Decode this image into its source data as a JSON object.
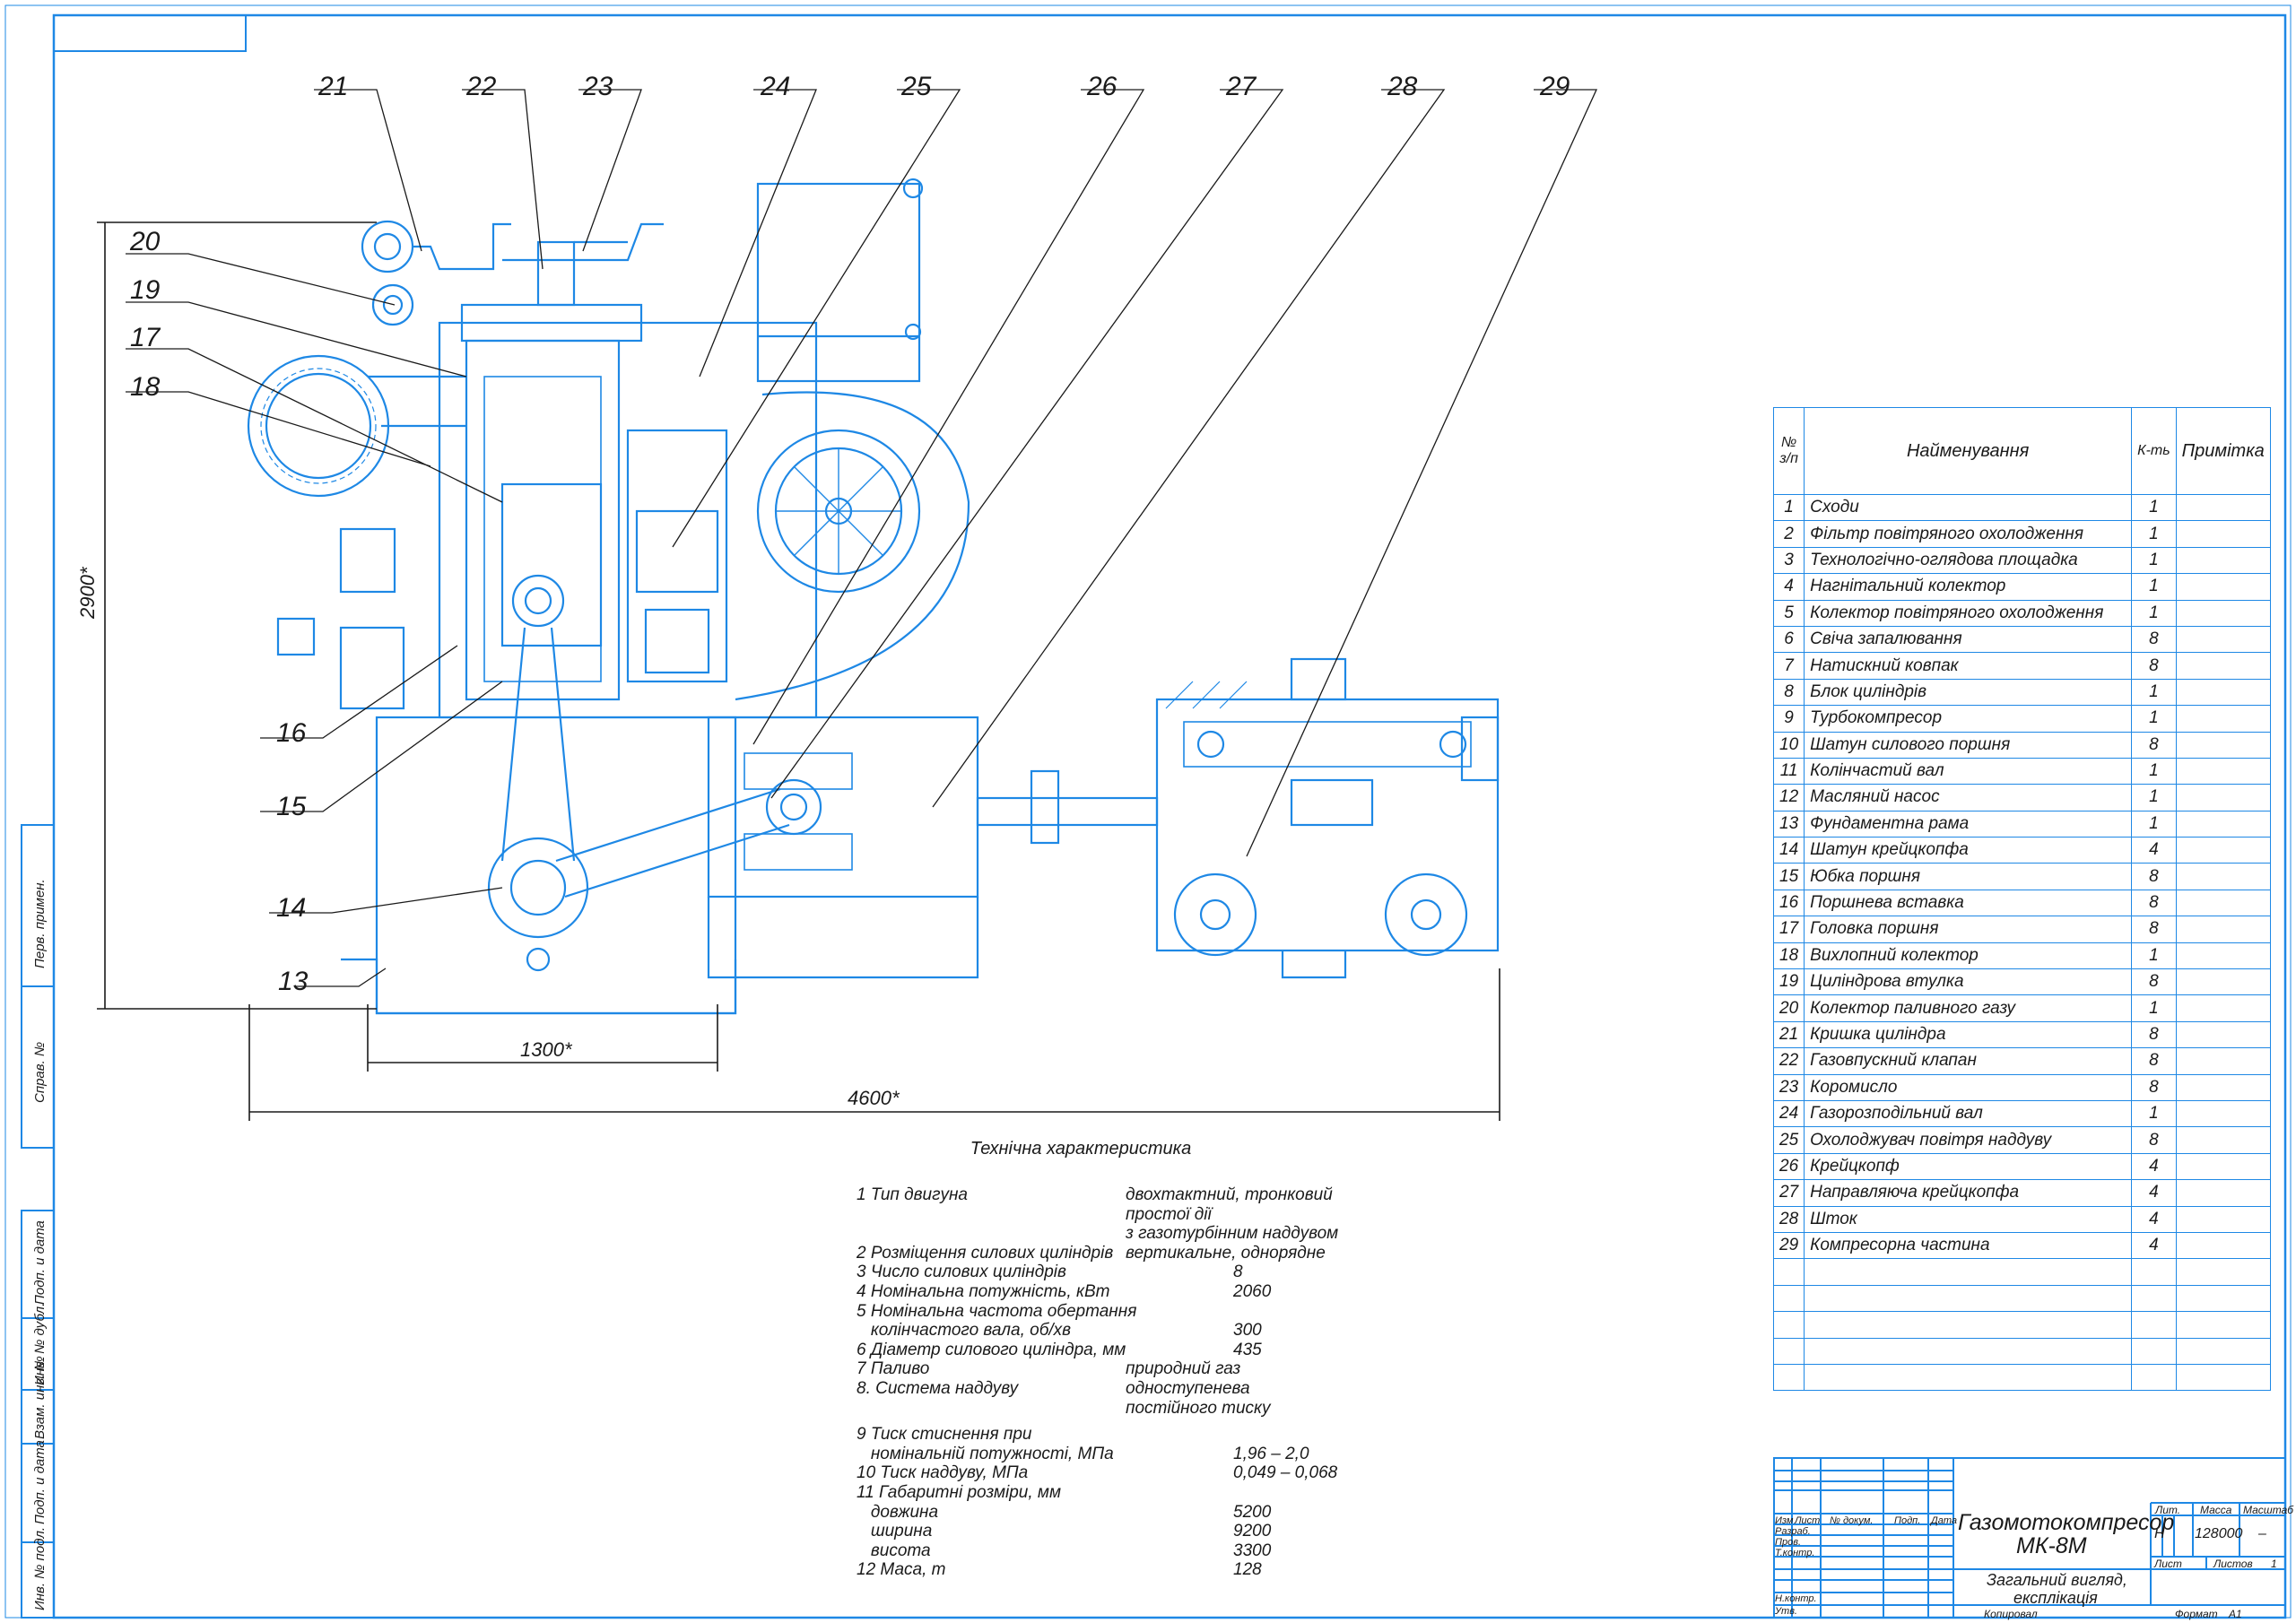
{
  "callouts": [
    "13",
    "14",
    "15",
    "16",
    "17",
    "18",
    "19",
    "20",
    "21",
    "22",
    "23",
    "24",
    "25",
    "26",
    "27",
    "28",
    "29"
  ],
  "dimensions": {
    "height": "2900*",
    "base_width": "1300*",
    "total_width": "4600*"
  },
  "spec_table": {
    "headers": {
      "num": "№ з/п",
      "name": "Найменування",
      "qty": "К-ть",
      "note": "Примітка"
    },
    "rows": [
      {
        "n": "1",
        "name": "Сходи",
        "q": "1"
      },
      {
        "n": "2",
        "name": "Фільтр повітряного охолодження",
        "q": "1"
      },
      {
        "n": "3",
        "name": "Технологічно-оглядова площадка",
        "q": "1"
      },
      {
        "n": "4",
        "name": "Нагнітальний колектор",
        "q": "1"
      },
      {
        "n": "5",
        "name": "Колектор повітряного охолодження",
        "q": "1"
      },
      {
        "n": "6",
        "name": "Свіча запалювання",
        "q": "8"
      },
      {
        "n": "7",
        "name": "Натискний ковпак",
        "q": "8"
      },
      {
        "n": "8",
        "name": "Блок циліндрів",
        "q": "1"
      },
      {
        "n": "9",
        "name": "Турбокомпресор",
        "q": "1"
      },
      {
        "n": "10",
        "name": "Шатун силового поршня",
        "q": "8"
      },
      {
        "n": "11",
        "name": "Колінчастий вал",
        "q": "1"
      },
      {
        "n": "12",
        "name": "Масляний насос",
        "q": "1"
      },
      {
        "n": "13",
        "name": "Фундаментна рама",
        "q": "1"
      },
      {
        "n": "14",
        "name": "Шатун крейцкопфа",
        "q": "4"
      },
      {
        "n": "15",
        "name": "Юбка поршня",
        "q": "8"
      },
      {
        "n": "16",
        "name": "Поршнева вставка",
        "q": "8"
      },
      {
        "n": "17",
        "name": "Головка поршня",
        "q": "8"
      },
      {
        "n": "18",
        "name": "Вихлопний колектор",
        "q": "1"
      },
      {
        "n": "19",
        "name": "Циліндрова втулка",
        "q": "8"
      },
      {
        "n": "20",
        "name": "Колектор паливного газу",
        "q": "1"
      },
      {
        "n": "21",
        "name": "Кришка циліндра",
        "q": "8"
      },
      {
        "n": "22",
        "name": "Газовпускний клапан",
        "q": "8"
      },
      {
        "n": "23",
        "name": "Коромисло",
        "q": "8"
      },
      {
        "n": "24",
        "name": "Газорозподільний вал",
        "q": "1"
      },
      {
        "n": "25",
        "name": "Охолоджувач повітря наддуву",
        "q": "8"
      },
      {
        "n": "26",
        "name": "Крейцкопф",
        "q": "4"
      },
      {
        "n": "27",
        "name": "Направляюча крейцкопфа",
        "q": "4"
      },
      {
        "n": "28",
        "name": "Шток",
        "q": "4"
      },
      {
        "n": "29",
        "name": "Компресорна частина",
        "q": "4"
      }
    ]
  },
  "tech": {
    "title": "Технічна характеристика",
    "lines": [
      {
        "label": "1 Тип двигуна",
        "value": "двохтактний, тронковий"
      },
      {
        "label": "",
        "value": "простої дії"
      },
      {
        "label": "",
        "value": "з газотурбінним наддувом"
      },
      {
        "label": "2 Розміщення силових циліндрів",
        "value": "вертикальне, однорядне"
      },
      {
        "label": "3 Число силових циліндрів",
        "value": "8"
      },
      {
        "label": "4 Номінальна потужність, кВт",
        "value": "2060"
      },
      {
        "label": "5 Номінальна частота обертання",
        "value": ""
      },
      {
        "label": "   колінчастого вала, об/хв",
        "value": "300"
      },
      {
        "label": "6 Діаметр силового циліндра, мм",
        "value": "435"
      },
      {
        "label": "7 Паливо",
        "value": "природний газ"
      },
      {
        "label": "8. Система наддуву",
        "value": "одноступенева"
      },
      {
        "label": "",
        "value": "постійного тиску"
      },
      {
        "label": "9 Тиск стиснення при",
        "value": ""
      },
      {
        "label": "   номінальній потужності, МПа",
        "value": "1,96 – 2,0"
      },
      {
        "label": "10 Тиск наддуву, МПа",
        "value": "0,049 – 0,068"
      },
      {
        "label": "11 Габаритні розміри, мм",
        "value": ""
      },
      {
        "label": "   довжина",
        "value": "5200"
      },
      {
        "label": "   ширина",
        "value": "9200"
      },
      {
        "label": "   висота",
        "value": "3300"
      },
      {
        "label": "12 Маса, т",
        "value": "128"
      }
    ]
  },
  "title_block": {
    "product": "Газомотокомпресор",
    "model": "МК-8М",
    "subtitle1": "Загальний вигляд,",
    "subtitle2": "експлікація",
    "col_izm": "Изм",
    "col_list": "Лист",
    "col_doc": "№ докум.",
    "col_sign": "Подп.",
    "col_date": "Дата",
    "row_razrab": "Разраб.",
    "row_prov": "Пров.",
    "row_tkontr": "Т.контр.",
    "row_nkontr": "Н.контр.",
    "row_utv": "Утв.",
    "lit": "Лит.",
    "mass": "Масса",
    "scale": "Масштаб",
    "lit_value": "Н",
    "mass_value": "128000",
    "scale_value": "–",
    "sheet": "Лист",
    "sheets": "Листов",
    "sheets_value": "1",
    "copied": "Копировал",
    "format": "Формат",
    "format_value": "А1"
  },
  "side_stamp": {
    "perv": "Перв. примен.",
    "sprav": "Справ. №",
    "podp_data1": "Подп. и дата",
    "inv_dubl": "Инв. № дубл.",
    "vzam_inv": "Взам. инв. №",
    "podp_data2": "Подп. и дата",
    "inv_podl": "Инв. № подл."
  }
}
